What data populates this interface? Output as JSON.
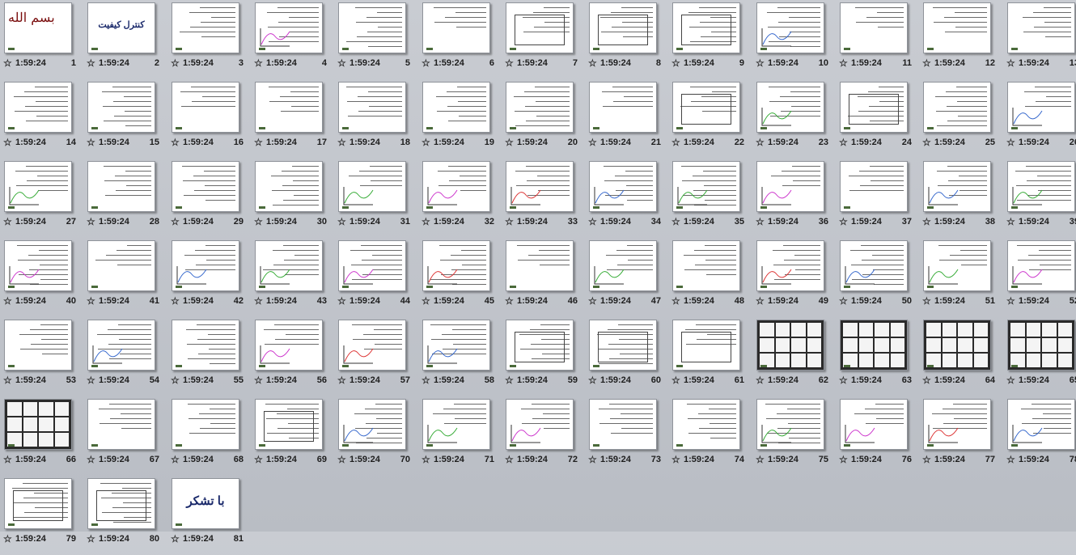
{
  "app": {
    "view": "Slide Sorter"
  },
  "slides": [
    {
      "num": "1",
      "time": "1:59:24",
      "kind": "logo",
      "text": "بسم الله"
    },
    {
      "num": "2",
      "time": "1:59:24",
      "kind": "title",
      "text": "کنترل کیفیت"
    },
    {
      "num": "3",
      "time": "1:59:24",
      "kind": "text"
    },
    {
      "num": "4",
      "time": "1:59:24",
      "kind": "chart"
    },
    {
      "num": "5",
      "time": "1:59:24",
      "kind": "text"
    },
    {
      "num": "6",
      "time": "1:59:24",
      "kind": "text"
    },
    {
      "num": "7",
      "time": "1:59:24",
      "kind": "diagram"
    },
    {
      "num": "8",
      "time": "1:59:24",
      "kind": "diagram"
    },
    {
      "num": "9",
      "time": "1:59:24",
      "kind": "diagram"
    },
    {
      "num": "10",
      "time": "1:59:24",
      "kind": "chart"
    },
    {
      "num": "11",
      "time": "1:59:24",
      "kind": "text"
    },
    {
      "num": "12",
      "time": "1:59:24",
      "kind": "text"
    },
    {
      "num": "13",
      "time": "1:59:24",
      "kind": "text"
    },
    {
      "num": "14",
      "time": "1:59:24",
      "kind": "text"
    },
    {
      "num": "15",
      "time": "1:59:24",
      "kind": "text"
    },
    {
      "num": "16",
      "time": "1:59:24",
      "kind": "text"
    },
    {
      "num": "17",
      "time": "1:59:24",
      "kind": "text"
    },
    {
      "num": "18",
      "time": "1:59:24",
      "kind": "text"
    },
    {
      "num": "19",
      "time": "1:59:24",
      "kind": "text"
    },
    {
      "num": "20",
      "time": "1:59:24",
      "kind": "text"
    },
    {
      "num": "21",
      "time": "1:59:24",
      "kind": "text"
    },
    {
      "num": "22",
      "time": "1:59:24",
      "kind": "diagram"
    },
    {
      "num": "23",
      "time": "1:59:24",
      "kind": "chart"
    },
    {
      "num": "24",
      "time": "1:59:24",
      "kind": "diagram"
    },
    {
      "num": "25",
      "time": "1:59:24",
      "kind": "text"
    },
    {
      "num": "26",
      "time": "1:59:24",
      "kind": "chart"
    },
    {
      "num": "27",
      "time": "1:59:24",
      "kind": "chart"
    },
    {
      "num": "28",
      "time": "1:59:24",
      "kind": "text"
    },
    {
      "num": "29",
      "time": "1:59:24",
      "kind": "text"
    },
    {
      "num": "30",
      "time": "1:59:24",
      "kind": "text"
    },
    {
      "num": "31",
      "time": "1:59:24",
      "kind": "chart"
    },
    {
      "num": "32",
      "time": "1:59:24",
      "kind": "chart"
    },
    {
      "num": "33",
      "time": "1:59:24",
      "kind": "chart"
    },
    {
      "num": "34",
      "time": "1:59:24",
      "kind": "chart"
    },
    {
      "num": "35",
      "time": "1:59:24",
      "kind": "chart"
    },
    {
      "num": "36",
      "time": "1:59:24",
      "kind": "chart"
    },
    {
      "num": "37",
      "time": "1:59:24",
      "kind": "text"
    },
    {
      "num": "38",
      "time": "1:59:24",
      "kind": "chart"
    },
    {
      "num": "39",
      "time": "1:59:24",
      "kind": "chart"
    },
    {
      "num": "40",
      "time": "1:59:24",
      "kind": "chart"
    },
    {
      "num": "41",
      "time": "1:59:24",
      "kind": "text"
    },
    {
      "num": "42",
      "time": "1:59:24",
      "kind": "chart"
    },
    {
      "num": "43",
      "time": "1:59:24",
      "kind": "chart"
    },
    {
      "num": "44",
      "time": "1:59:24",
      "kind": "chart"
    },
    {
      "num": "45",
      "time": "1:59:24",
      "kind": "chart"
    },
    {
      "num": "46",
      "time": "1:59:24",
      "kind": "text"
    },
    {
      "num": "47",
      "time": "1:59:24",
      "kind": "chart"
    },
    {
      "num": "48",
      "time": "1:59:24",
      "kind": "text"
    },
    {
      "num": "49",
      "time": "1:59:24",
      "kind": "chart"
    },
    {
      "num": "50",
      "time": "1:59:24",
      "kind": "chart"
    },
    {
      "num": "51",
      "time": "1:59:24",
      "kind": "chart"
    },
    {
      "num": "52",
      "time": "1:59:24",
      "kind": "chart"
    },
    {
      "num": "53",
      "time": "1:59:24",
      "kind": "text"
    },
    {
      "num": "54",
      "time": "1:59:24",
      "kind": "chart"
    },
    {
      "num": "55",
      "time": "1:59:24",
      "kind": "text"
    },
    {
      "num": "56",
      "time": "1:59:24",
      "kind": "chart"
    },
    {
      "num": "57",
      "time": "1:59:24",
      "kind": "chart"
    },
    {
      "num": "58",
      "time": "1:59:24",
      "kind": "chart"
    },
    {
      "num": "59",
      "time": "1:59:24",
      "kind": "diagram"
    },
    {
      "num": "60",
      "time": "1:59:24",
      "kind": "table"
    },
    {
      "num": "61",
      "time": "1:59:24",
      "kind": "diagram"
    },
    {
      "num": "62",
      "time": "1:59:24",
      "kind": "dark"
    },
    {
      "num": "63",
      "time": "1:59:24",
      "kind": "dark"
    },
    {
      "num": "64",
      "time": "1:59:24",
      "kind": "dark"
    },
    {
      "num": "65",
      "time": "1:59:24",
      "kind": "dark"
    },
    {
      "num": "66",
      "time": "1:59:24",
      "kind": "dark"
    },
    {
      "num": "67",
      "time": "1:59:24",
      "kind": "text"
    },
    {
      "num": "68",
      "time": "1:59:24",
      "kind": "text"
    },
    {
      "num": "69",
      "time": "1:59:24",
      "kind": "table"
    },
    {
      "num": "70",
      "time": "1:59:24",
      "kind": "chart"
    },
    {
      "num": "71",
      "time": "1:59:24",
      "kind": "chart"
    },
    {
      "num": "72",
      "time": "1:59:24",
      "kind": "chart"
    },
    {
      "num": "73",
      "time": "1:59:24",
      "kind": "text"
    },
    {
      "num": "74",
      "time": "1:59:24",
      "kind": "text"
    },
    {
      "num": "75",
      "time": "1:59:24",
      "kind": "chart"
    },
    {
      "num": "76",
      "time": "1:59:24",
      "kind": "chart"
    },
    {
      "num": "77",
      "time": "1:59:24",
      "kind": "chart"
    },
    {
      "num": "78",
      "time": "1:59:24",
      "kind": "chart"
    },
    {
      "num": "79",
      "time": "1:59:24",
      "kind": "diagram"
    },
    {
      "num": "80",
      "time": "1:59:24",
      "kind": "diagram"
    },
    {
      "num": "81",
      "time": "1:59:24",
      "kind": "title-big",
      "text": "با تشکر"
    }
  ],
  "colors": {
    "background": "#c3c6cc",
    "thumb_border": "#8f939a",
    "title_text": "#1b2a6b"
  },
  "icons": {
    "transition": "star-icon"
  }
}
